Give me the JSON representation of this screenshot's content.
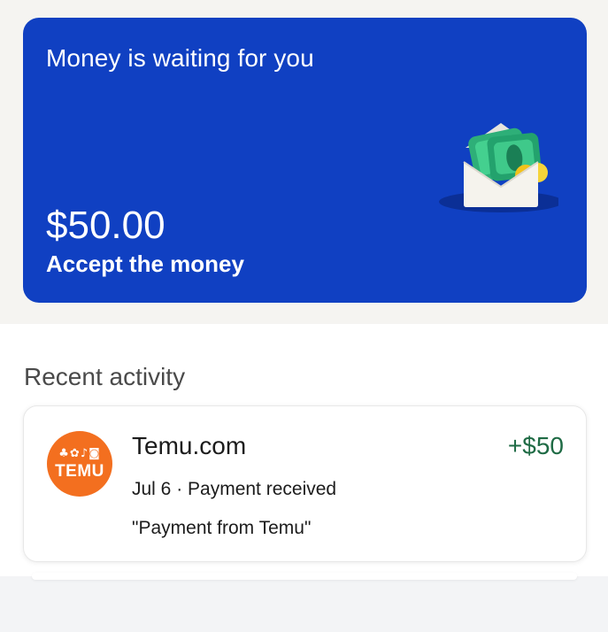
{
  "money_card": {
    "title": "Money is waiting for you",
    "amount": "$50.00",
    "action": "Accept the money",
    "background_color": "#1040c2",
    "illustration": "envelope-money-icon"
  },
  "recent_activity": {
    "title": "Recent activity",
    "items": [
      {
        "merchant": "Temu.com",
        "logo_text": "TEMU",
        "logo_icons": "♣✿♪◙",
        "logo_color": "#f36f1f",
        "amount": "+$50",
        "amount_color": "#1f6b45",
        "meta": "Jul 6 · Payment received",
        "note": "\"Payment from Temu\""
      }
    ]
  }
}
